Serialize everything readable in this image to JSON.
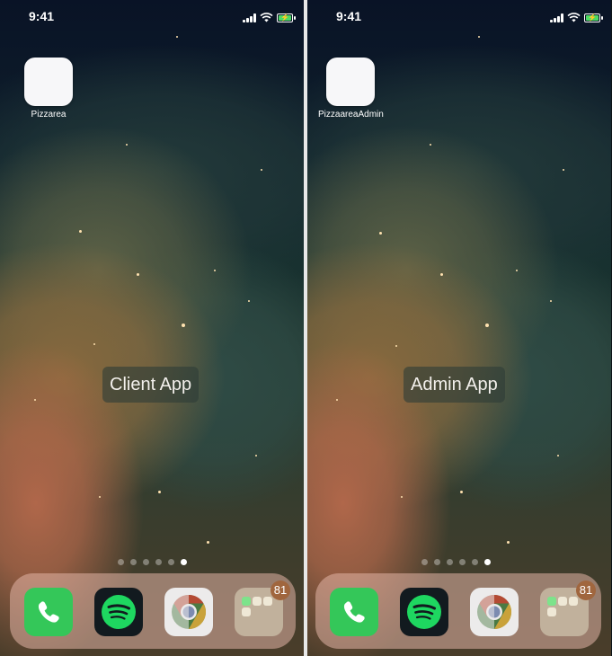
{
  "status": {
    "time": "9:41"
  },
  "left_screen": {
    "app_label": "Pizzarea",
    "caption": "Client App",
    "badge": "81"
  },
  "right_screen": {
    "app_label": "PizzaareaAdmin",
    "caption": "Admin App",
    "badge": "81"
  },
  "colors": {
    "phone_green": "#34c759",
    "spotify_green": "#1ed760",
    "battery_green": "#4cd964",
    "badge_brown": "#a0663e"
  },
  "icons": [
    "phone-icon",
    "spotify-icon",
    "chrome-icon",
    "folder-icon",
    "wifi-icon",
    "signal-icon",
    "battery-icon"
  ]
}
